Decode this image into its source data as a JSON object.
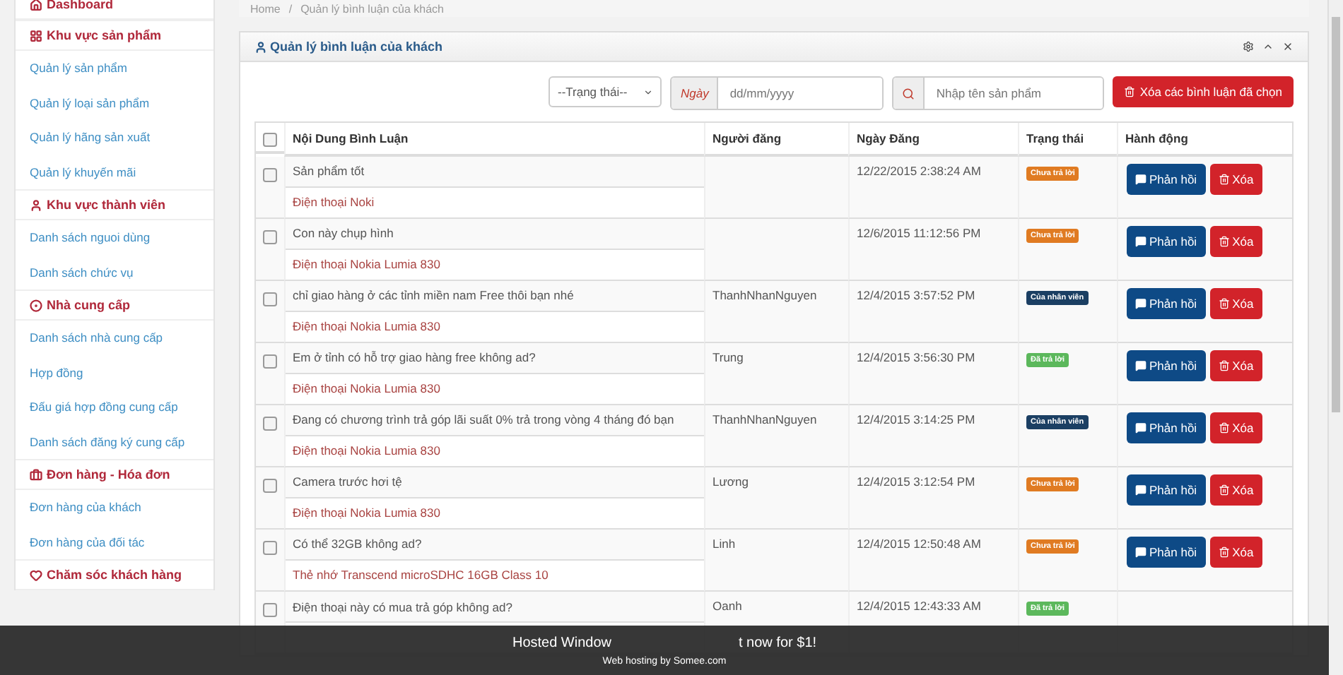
{
  "sidebar": {
    "items": [
      {
        "kind": "header",
        "label": "Dashboard"
      },
      {
        "kind": "header",
        "label": "Khu vực sản phẩm"
      },
      {
        "kind": "link",
        "label": "Quản lý sản phẩm"
      },
      {
        "kind": "link",
        "label": "Quản lý loại sản phẩm"
      },
      {
        "kind": "link",
        "label": "Quản lý hãng sản xuất"
      },
      {
        "kind": "link",
        "label": "Quản lý khuyến mãi"
      },
      {
        "kind": "header",
        "label": "Khu vực thành viên"
      },
      {
        "kind": "link",
        "label": "Danh sách nguoi dùng"
      },
      {
        "kind": "link",
        "label": "Danh sách chức vụ"
      },
      {
        "kind": "header",
        "label": "Nhà cung cấp"
      },
      {
        "kind": "link",
        "label": "Danh sách nhà cung cấp"
      },
      {
        "kind": "link",
        "label": "Hợp đồng"
      },
      {
        "kind": "link",
        "label": "Đấu giá hợp đồng cung cấp"
      },
      {
        "kind": "link",
        "label": "Danh sách đăng ký cung cấp"
      },
      {
        "kind": "header",
        "label": "Đơn hàng - Hóa đơn"
      },
      {
        "kind": "link",
        "label": "Đơn hàng của khách"
      },
      {
        "kind": "link",
        "label": "Đơn hàng của đối tác"
      },
      {
        "kind": "header",
        "label": "Chăm sóc khách hàng"
      }
    ]
  },
  "breadcrumb": {
    "items": [
      "Home",
      "Quản lý bình luận của khách"
    ],
    "separator": "/"
  },
  "panel": {
    "title": "Quản lý bình luận của khách",
    "status_select": "--Trạng thái--",
    "date_label": "Ngày",
    "date_placeholder": "dd/mm/yyyy",
    "search_placeholder": "Nhập tên sản phẩm",
    "delete_selected": "Xóa các bình luận đã chọn",
    "table": {
      "select_all_checked": false,
      "columns": [
        "Nội Dung Bình Luận",
        "Người đăng",
        "Ngày Đăng",
        "Trạng thái",
        "Hành động"
      ],
      "rows": [
        {
          "checked": false,
          "comment": "Sản phẩm tốt",
          "product": "Điện thoại Noki",
          "poster": "",
          "date": "12/22/2015 2:38:24 AM",
          "status": {
            "kind": "pending",
            "label": "Chưa trả lời"
          },
          "reply_label": "Phản hồi",
          "delete_label": "Xóa"
        },
        {
          "checked": false,
          "comment": "Con này chụp hình",
          "product": "Điện thoại Nokia Lumia 830",
          "poster": "",
          "date": "12/6/2015 11:12:56 PM",
          "status": {
            "kind": "pending",
            "label": "Chưa trả lời"
          },
          "reply_label": "Phản hồi",
          "delete_label": "Xóa"
        },
        {
          "checked": false,
          "comment": "chỉ giao hàng ở các tỉnh miền nam Free thôi bạn nhé",
          "product": "Điện thoại Nokia Lumia 830",
          "poster": "ThanhNhanNguyen",
          "date": "12/4/2015 3:57:52 PM",
          "status": {
            "kind": "staff",
            "label": "Của nhân viên"
          },
          "reply_label": "Phản hồi",
          "delete_label": "Xóa"
        },
        {
          "checked": false,
          "comment": "Em ở tỉnh có hỗ trợ giao hàng free không ad?",
          "product": "Điện thoại Nokia Lumia 830",
          "poster": "Trung",
          "date": "12/4/2015 3:56:30 PM",
          "status": {
            "kind": "answered",
            "label": "Đã trả lời"
          },
          "reply_label": "Phản hồi",
          "delete_label": "Xóa"
        },
        {
          "checked": false,
          "comment": "Đang có chương trình trả góp lãi suất 0% trả trong vòng 4 tháng đó bạn",
          "product": "Điện thoại Nokia Lumia 830",
          "poster": "ThanhNhanNguyen",
          "date": "12/4/2015 3:14:25 PM",
          "status": {
            "kind": "staff",
            "label": "Của nhân viên"
          },
          "reply_label": "Phản hồi",
          "delete_label": "Xóa"
        },
        {
          "checked": false,
          "comment": "Camera trước hơi tệ",
          "product": "Điện thoại Nokia Lumia 830",
          "poster": "Lương",
          "date": "12/4/2015 3:12:54 PM",
          "status": {
            "kind": "pending",
            "label": "Chưa trả lời"
          },
          "reply_label": "Phản hồi",
          "delete_label": "Xóa"
        },
        {
          "checked": false,
          "comment": "Có thể 32GB không ad?",
          "product": "Thẻ nhớ Transcend microSDHC 16GB Class 10",
          "poster": "Linh",
          "date": "12/4/2015 12:50:48 AM",
          "status": {
            "kind": "pending",
            "label": "Chưa trả lời"
          },
          "reply_label": "Phản hồi",
          "delete_label": "Xóa"
        },
        {
          "checked": false,
          "comment": "Điện thoại này có mua trả góp không ad?",
          "product": "",
          "poster": "Oanh",
          "date": "12/4/2015 12:43:33 AM",
          "status": {
            "kind": "answered",
            "label": "Đã trả lời"
          }
        }
      ]
    }
  },
  "banner": {
    "line_start": "Hosted Window",
    "line_end": "t now for $1!",
    "subline": "Web hosting by Somee.com"
  }
}
